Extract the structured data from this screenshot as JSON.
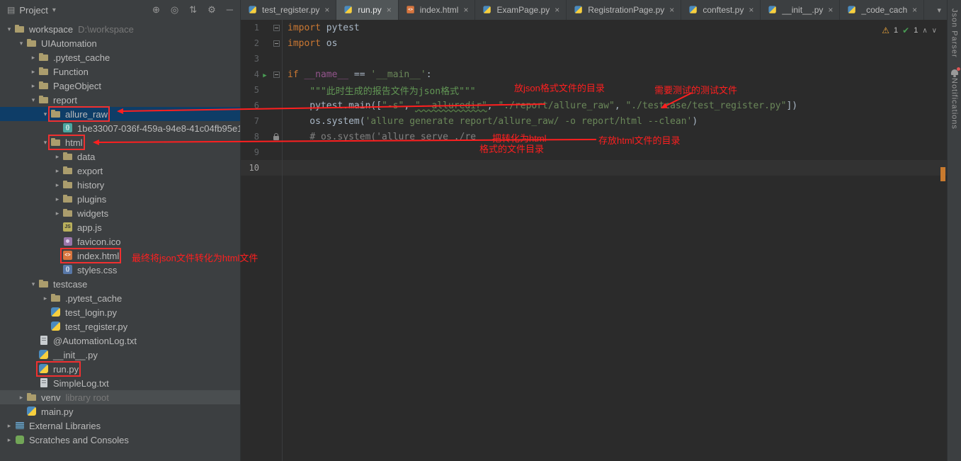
{
  "colors": {
    "annotation_red": "#ff1f1f",
    "selection_blue": "#0e3d67",
    "warning_yellow": "#f2a93c",
    "ok_green": "#499c54",
    "scroll_mark_orange": "#c87a2e"
  },
  "project_panel": {
    "title": "Project",
    "dropdown_arrow": "▾",
    "header_icons": [
      {
        "name": "locate-icon",
        "glyph": "⊕"
      },
      {
        "name": "scroll-from-source-icon",
        "glyph": "◎"
      },
      {
        "name": "collapse-all-icon",
        "glyph": "⇅"
      },
      {
        "name": "settings-icon",
        "glyph": "⚙"
      },
      {
        "name": "hide-panel-icon",
        "glyph": "─"
      }
    ]
  },
  "project_tree": {
    "items": [
      {
        "label": "workspace",
        "suffix": "D:\\workspace",
        "icon": "folder",
        "level": 0,
        "state": "expanded"
      },
      {
        "label": "UIAutomation",
        "icon": "folder",
        "level": 1,
        "state": "expanded"
      },
      {
        "label": ".pytest_cache",
        "icon": "folder",
        "level": 2,
        "state": "collapsed"
      },
      {
        "label": "Function",
        "icon": "folder",
        "level": 2,
        "state": "collapsed"
      },
      {
        "label": "PageObject",
        "icon": "folder",
        "level": 2,
        "state": "collapsed"
      },
      {
        "label": "report",
        "icon": "folder",
        "level": 2,
        "state": "expanded"
      },
      {
        "label": "allure_raw",
        "icon": "folder",
        "level": 3,
        "state": "expanded",
        "selected": true,
        "red_box": true
      },
      {
        "label": "1be33007-036f-459a-94e8-41c04fb95e1...",
        "icon": "json-file",
        "level": 4
      },
      {
        "label": "html",
        "icon": "folder",
        "level": 3,
        "state": "expanded",
        "red_box": true
      },
      {
        "label": "data",
        "icon": "folder",
        "level": 4,
        "state": "collapsed"
      },
      {
        "label": "export",
        "icon": "folder",
        "level": 4,
        "state": "collapsed"
      },
      {
        "label": "history",
        "icon": "folder",
        "level": 4,
        "state": "collapsed"
      },
      {
        "label": "plugins",
        "icon": "folder",
        "level": 4,
        "state": "collapsed"
      },
      {
        "label": "widgets",
        "icon": "folder",
        "level": 4,
        "state": "collapsed"
      },
      {
        "label": "app.js",
        "icon": "js-file",
        "level": 4
      },
      {
        "label": "favicon.ico",
        "icon": "image-file",
        "level": 4
      },
      {
        "label": "index.html",
        "icon": "html-file",
        "level": 4,
        "red_box": true
      },
      {
        "label": "styles.css",
        "icon": "css-file",
        "level": 4
      },
      {
        "label": "testcase",
        "icon": "folder",
        "level": 2,
        "state": "expanded"
      },
      {
        "label": ".pytest_cache",
        "icon": "folder",
        "level": 3,
        "state": "collapsed"
      },
      {
        "label": "test_login.py",
        "icon": "python-file",
        "level": 3
      },
      {
        "label": "test_register.py",
        "icon": "python-file",
        "level": 3
      },
      {
        "label": "@AutomationLog.txt",
        "icon": "text-file",
        "level": 2
      },
      {
        "label": "__init__.py",
        "icon": "python-file",
        "level": 2
      },
      {
        "label": "run.py",
        "icon": "python-file",
        "level": 2,
        "red_box": true
      },
      {
        "label": "SimpleLog.txt",
        "icon": "text-file",
        "level": 2
      },
      {
        "label": "venv",
        "suffix": "library root",
        "icon": "folder",
        "level": 1,
        "state": "collapsed",
        "band": true
      },
      {
        "label": "main.py",
        "icon": "python-file",
        "level": 1
      },
      {
        "label": "External Libraries",
        "icon": "library",
        "level": 0,
        "state": "collapsed"
      },
      {
        "label": "Scratches and Consoles",
        "icon": "scratches",
        "level": 0,
        "state": "collapsed"
      }
    ]
  },
  "editor": {
    "tabs": [
      {
        "label": "test_register.py",
        "icon": "python-file",
        "active": false
      },
      {
        "label": "run.py",
        "icon": "python-file",
        "active": true
      },
      {
        "label": "index.html",
        "icon": "html-file",
        "active": false
      },
      {
        "label": "ExamPage.py",
        "icon": "python-file",
        "active": false
      },
      {
        "label": "RegistrationPage.py",
        "icon": "python-file",
        "active": false
      },
      {
        "label": "conftest.py",
        "icon": "python-file",
        "active": false
      },
      {
        "label": "__init__.py",
        "icon": "python-file",
        "active": false
      },
      {
        "label": "_code_cach",
        "icon": "python-file",
        "active": false
      }
    ],
    "hidden_tabs_chevron": "▾",
    "inspections": {
      "warning_count": "1",
      "ok_count": "1",
      "warning_icon": "⚠",
      "ok_icon": "✔",
      "up": "∧",
      "down": "∨"
    },
    "current_line": 10,
    "lines": [
      {
        "num": "1",
        "fold": true,
        "segments": [
          {
            "t": "import",
            "c": "kw"
          },
          {
            "t": " pytest",
            "c": "plain"
          }
        ]
      },
      {
        "num": "2",
        "fold": true,
        "segments": [
          {
            "t": "import",
            "c": "kw"
          },
          {
            "t": " os",
            "c": "plain"
          }
        ]
      },
      {
        "num": "3",
        "segments": []
      },
      {
        "num": "4",
        "fold": true,
        "run": true,
        "segments": [
          {
            "t": "if ",
            "c": "kw"
          },
          {
            "t": "__name__",
            "c": "dunder"
          },
          {
            "t": " == ",
            "c": "plain"
          },
          {
            "t": "'__main__'",
            "c": "str"
          },
          {
            "t": ":",
            "c": "plain"
          }
        ]
      },
      {
        "num": "5",
        "segments": [
          {
            "t": "    ",
            "c": "plain"
          },
          {
            "t": "\"\"\"此时生成的报告文件为json格式\"\"\"",
            "c": "docstr"
          }
        ]
      },
      {
        "num": "6",
        "segments": [
          {
            "t": "    pytest.main([",
            "c": "plain"
          },
          {
            "t": "\"-s\"",
            "c": "str"
          },
          {
            "t": ", ",
            "c": "plain"
          },
          {
            "t": "\"--alluredir\"",
            "c": "str-typo"
          },
          {
            "t": ", ",
            "c": "plain"
          },
          {
            "t": "\"./report/allure_raw\"",
            "c": "str"
          },
          {
            "t": ", ",
            "c": "plain"
          },
          {
            "t": "\"./testcase/test_register.py\"",
            "c": "str"
          },
          {
            "t": "])",
            "c": "plain"
          }
        ]
      },
      {
        "num": "7",
        "segments": [
          {
            "t": "    os.system(",
            "c": "plain"
          },
          {
            "t": "'allure generate report/allure_raw/ -o report/html --clean'",
            "c": "str"
          },
          {
            "t": ")",
            "c": "plain"
          }
        ]
      },
      {
        "num": "8",
        "lock": true,
        "segments": [
          {
            "t": "    ",
            "c": "plain"
          },
          {
            "t": "# os.system('allure serve ./re",
            "c": "comment"
          }
        ]
      },
      {
        "num": "9",
        "segments": []
      },
      {
        "num": "10",
        "segments": []
      }
    ]
  },
  "right_strip": {
    "top_label": "Json Parser",
    "bottom_label": "Notifications"
  },
  "annotations": {
    "texts": [
      {
        "id": "json-dir",
        "text": "放json格式文件的目录"
      },
      {
        "id": "test-file",
        "text": "需要测试的测试文件"
      },
      {
        "id": "html-convert-1",
        "text": "把转化为html"
      },
      {
        "id": "html-convert-2",
        "text": "格式的文件目录"
      },
      {
        "id": "html-dir",
        "text": "存放html文件的目录"
      },
      {
        "id": "index-note",
        "text": "最终将json文件转化为html文件"
      }
    ]
  }
}
